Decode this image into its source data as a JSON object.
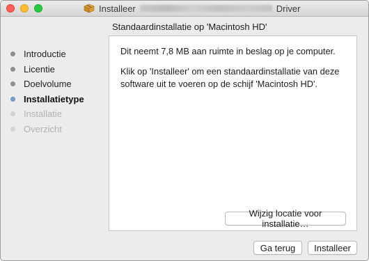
{
  "window": {
    "title_prefix": "Installeer",
    "title_suffix": "Driver"
  },
  "header": {
    "title": "Standaardinstallatie op 'Macintosh HD'"
  },
  "sidebar": {
    "steps": [
      {
        "label": "Introductie",
        "state": "done"
      },
      {
        "label": "Licentie",
        "state": "done"
      },
      {
        "label": "Doelvolume",
        "state": "done"
      },
      {
        "label": "Installatietype",
        "state": "current"
      },
      {
        "label": "Installatie",
        "state": "future"
      },
      {
        "label": "Overzicht",
        "state": "future"
      }
    ]
  },
  "main": {
    "message_1": "Dit neemt 7,8 MB aan ruimte in beslag op je computer.",
    "message_2": "Klik op 'Installeer' om een standaardinstallatie van deze software uit te voeren op de schijf 'Macintosh HD'.",
    "change_location_label": "Wijzig locatie voor installatie…"
  },
  "footer": {
    "back_label": "Ga terug",
    "install_label": "Installeer"
  },
  "colors": {
    "current_step_dot": "#7da1cf",
    "close": "#fd5f57",
    "minimize": "#febc2e",
    "maximize": "#2ac840"
  }
}
